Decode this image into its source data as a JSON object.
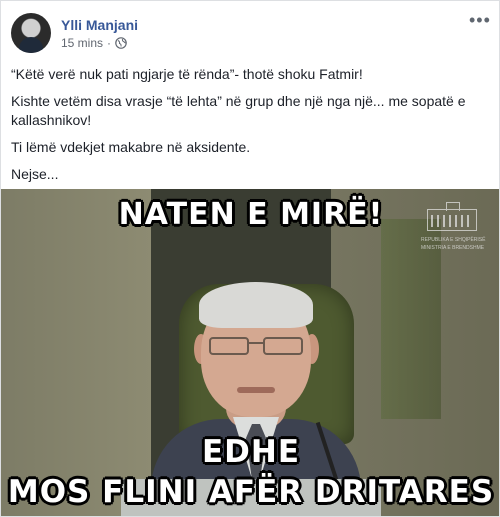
{
  "post": {
    "author": "Ylli Manjani",
    "timestamp": "15 mins",
    "separator": "·",
    "privacy_icon": "globe-icon",
    "more_icon": "more-options-icon",
    "paragraphs": [
      "“Këtë verë nuk pati ngjarje të rënda”- thotë shoku Fatmir!",
      "Kishte vetëm disa vrasje “të lehta” në grup dhe një nga një... me sopatë e kallashnikov!",
      "Ti lëmë vdekjet makabre në aksidente.",
      "Nejse..."
    ]
  },
  "image": {
    "top_caption": "NATEN E MIRË!",
    "middle_caption": "EDHE",
    "bottom_caption": "MOS FLINI AFËR DRITARES",
    "logo_line_1": "REPUBLIKA E SHQIPËRISË",
    "logo_line_2": "MINISTRIA E BRENDSHME"
  },
  "colors": {
    "author_link": "#385898",
    "text": "#1d2129",
    "meta": "#616770"
  }
}
